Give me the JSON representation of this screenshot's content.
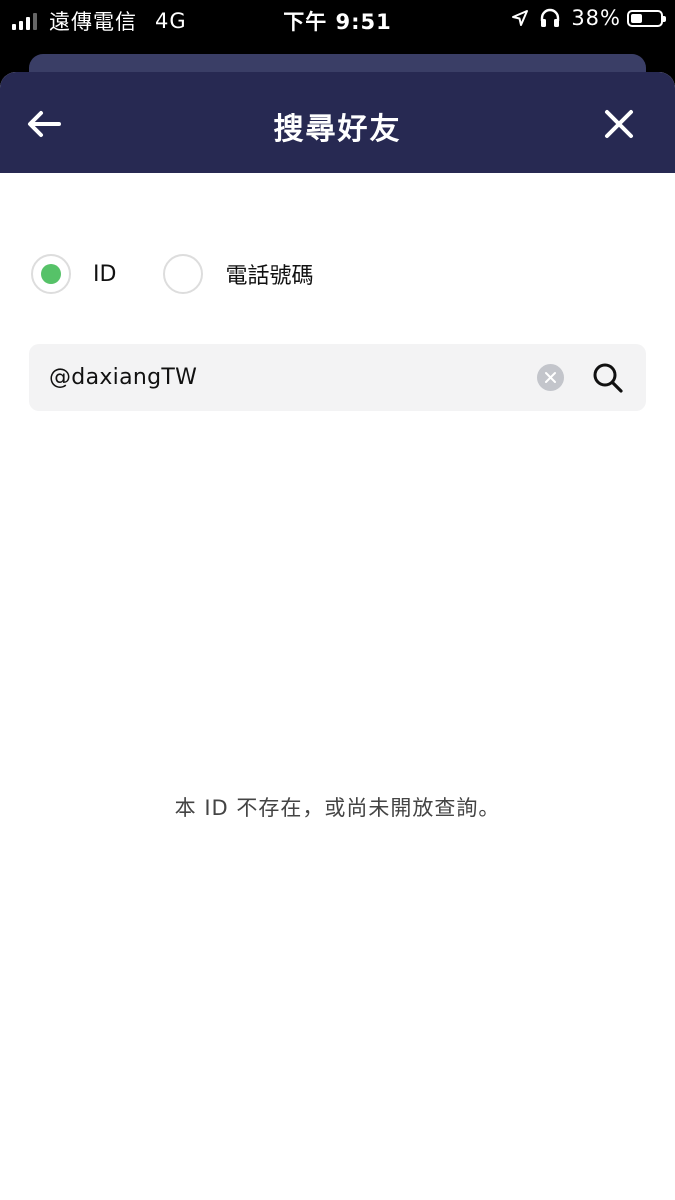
{
  "status_bar": {
    "carrier": "遠傳電信",
    "network": "4G",
    "time": "下午 9:51",
    "battery": "38%",
    "icons": [
      "signal-icon",
      "location-arrow-icon",
      "headphones-icon",
      "battery-icon"
    ]
  },
  "header": {
    "title": "搜尋好友",
    "back_icon": "arrow-left-icon",
    "close_icon": "close-icon",
    "background": "#272952"
  },
  "search_type": {
    "options": [
      {
        "label": "ID",
        "selected": true
      },
      {
        "label": "電話號碼",
        "selected": false
      }
    ],
    "accent": "#56c268"
  },
  "search": {
    "value": "@daxiangTW",
    "clear_icon": "clear-icon",
    "search_icon": "search-icon"
  },
  "result": {
    "message": "本 ID 不存在，或尚未開放查詢。"
  }
}
